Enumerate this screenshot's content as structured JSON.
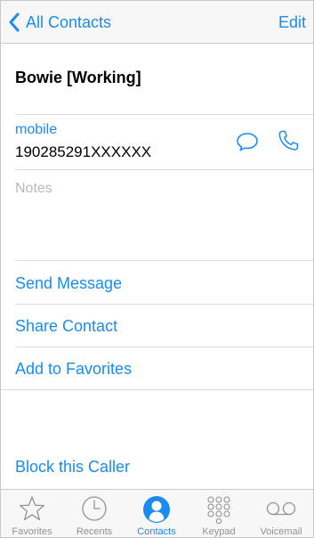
{
  "navbar": {
    "back_label": "All Contacts",
    "edit_label": "Edit"
  },
  "contact": {
    "name": "Bowie [Working]",
    "phone_type": "mobile",
    "phone_number": "190285291XXXXXX",
    "notes_placeholder": "Notes"
  },
  "actions": {
    "send_message": "Send Message",
    "share_contact": "Share Contact",
    "add_to_favorites": "Add to Favorites",
    "block_caller": "Block this Caller"
  },
  "tabbar": {
    "tabs": [
      {
        "label": "Favorites",
        "icon": "star-icon"
      },
      {
        "label": "Recents",
        "icon": "clock-icon"
      },
      {
        "label": "Contacts",
        "icon": "person-icon",
        "active": true
      },
      {
        "label": "Keypad",
        "icon": "keypad-icon"
      },
      {
        "label": "Voicemail",
        "icon": "voicemail-icon"
      }
    ]
  },
  "colors": {
    "accent": "#1a8cf0",
    "inactive_tab": "#929292",
    "placeholder": "#b7b7bc",
    "separator": "#dcdcdf"
  }
}
